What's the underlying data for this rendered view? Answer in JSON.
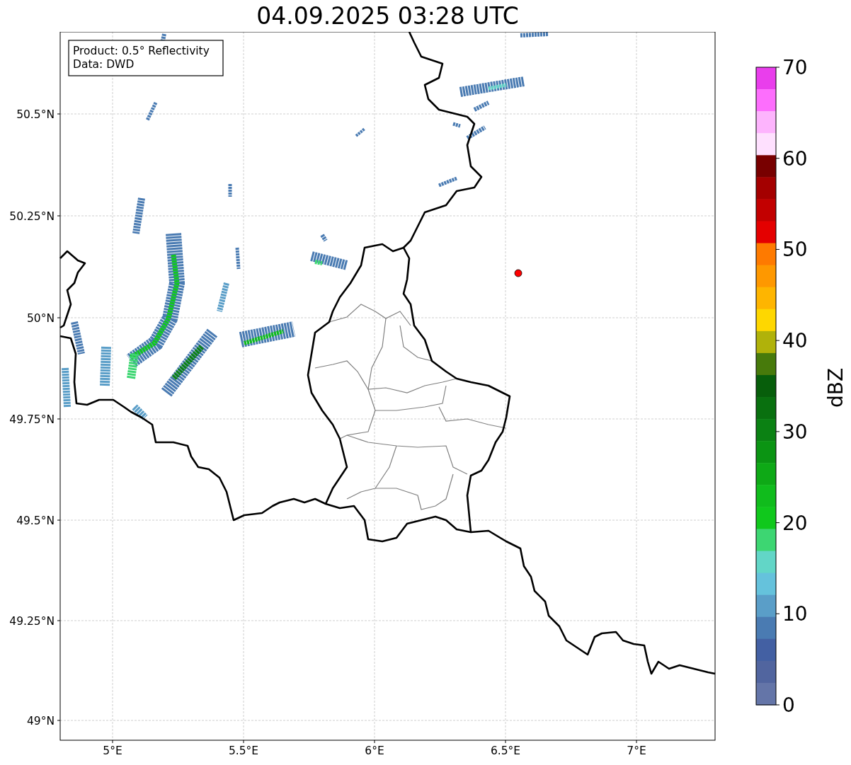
{
  "title": "04.09.2025 03:28 UTC",
  "map": {
    "info_lines": [
      "Product: 0.5° Reflectivity",
      "Data: DWD"
    ],
    "lat_labels": [
      "50.5°N",
      "50.25°N",
      "50°N",
      "49.75°N",
      "49.5°N",
      "49.25°N",
      "49°N"
    ],
    "lon_labels": [
      "5°E",
      "5.5°E",
      "6°E",
      "6.5°E",
      "7°E"
    ]
  },
  "colorbar": {
    "label": "dBZ",
    "ticks": [
      "70",
      "60",
      "50",
      "40",
      "30",
      "20",
      "10",
      "0"
    ],
    "bands": [
      {
        "color": "#e93eec"
      },
      {
        "color": "#fd6efd"
      },
      {
        "color": "#fdb4fd"
      },
      {
        "color": "#fee0fe"
      },
      {
        "color": "#780000"
      },
      {
        "color": "#a40000"
      },
      {
        "color": "#c20000"
      },
      {
        "color": "#e40000"
      },
      {
        "color": "#fe7a00"
      },
      {
        "color": "#fe9800"
      },
      {
        "color": "#feb500"
      },
      {
        "color": "#fed700"
      },
      {
        "color": "#b0b20a"
      },
      {
        "color": "#477a0b"
      },
      {
        "color": "#075e0b"
      },
      {
        "color": "#09700f"
      },
      {
        "color": "#0b8113"
      },
      {
        "color": "#0b9413"
      },
      {
        "color": "#0ea916"
      },
      {
        "color": "#10bc1c"
      },
      {
        "color": "#10c81c"
      },
      {
        "color": "#3dd672"
      },
      {
        "color": "#62d6c7"
      },
      {
        "color": "#65c2dc"
      },
      {
        "color": "#5a9ec8"
      },
      {
        "color": "#4a7bb2"
      },
      {
        "color": "#4360a3"
      },
      {
        "color": "#51659f"
      },
      {
        "color": "#6475a8"
      }
    ]
  }
}
